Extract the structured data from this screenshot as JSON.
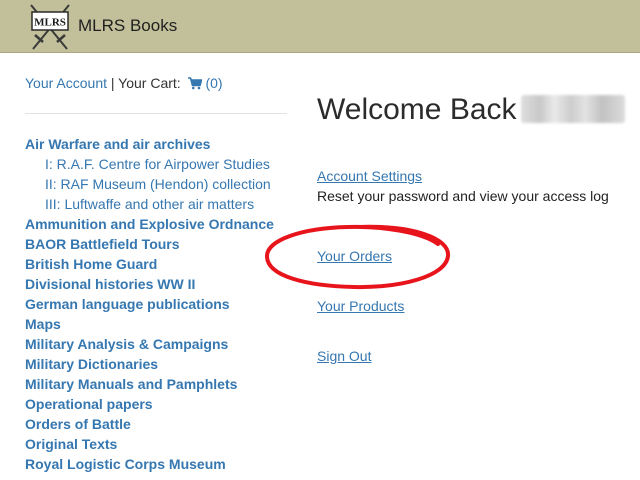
{
  "header": {
    "logo_text": "MLRS",
    "brand": "MLRS Books"
  },
  "account_bar": {
    "account_link": "Your Account",
    "separator": "|",
    "cart_label": "Your Cart:",
    "cart_icon": "shopping-cart-icon",
    "cart_count": "(0)"
  },
  "categories": [
    {
      "label": "Air Warfare and air archives",
      "level": 0
    },
    {
      "label": "I: R.A.F. Centre for Airpower Studies",
      "level": 1
    },
    {
      "label": "II: RAF Museum (Hendon) collection",
      "level": 1
    },
    {
      "label": "III: Luftwaffe and other air matters",
      "level": 1
    },
    {
      "label": "Ammunition and Explosive Ordnance",
      "level": 0
    },
    {
      "label": "BAOR Battlefield Tours",
      "level": 0
    },
    {
      "label": "British Home Guard",
      "level": 0
    },
    {
      "label": "Divisional histories WW II",
      "level": 0
    },
    {
      "label": "German language publications",
      "level": 0
    },
    {
      "label": "Maps",
      "level": 0
    },
    {
      "label": "Military Analysis & Campaigns",
      "level": 0
    },
    {
      "label": "Military Dictionaries",
      "level": 0
    },
    {
      "label": "Military Manuals and Pamphlets",
      "level": 0
    },
    {
      "label": "Operational papers",
      "level": 0
    },
    {
      "label": "Orders of Battle",
      "level": 0
    },
    {
      "label": "Original Texts",
      "level": 0
    },
    {
      "label": "Royal Logistic Corps Museum",
      "level": 0
    }
  ],
  "main": {
    "welcome": "Welcome Back",
    "account_settings": "Account Settings",
    "account_settings_desc": "Reset your password and view your access log",
    "your_orders": "Your Orders",
    "your_products": "Your Products",
    "sign_out": "Sign Out"
  },
  "colors": {
    "header_bg": "#c2c09a",
    "link": "#3577b0",
    "annotation": "#e8141c"
  }
}
